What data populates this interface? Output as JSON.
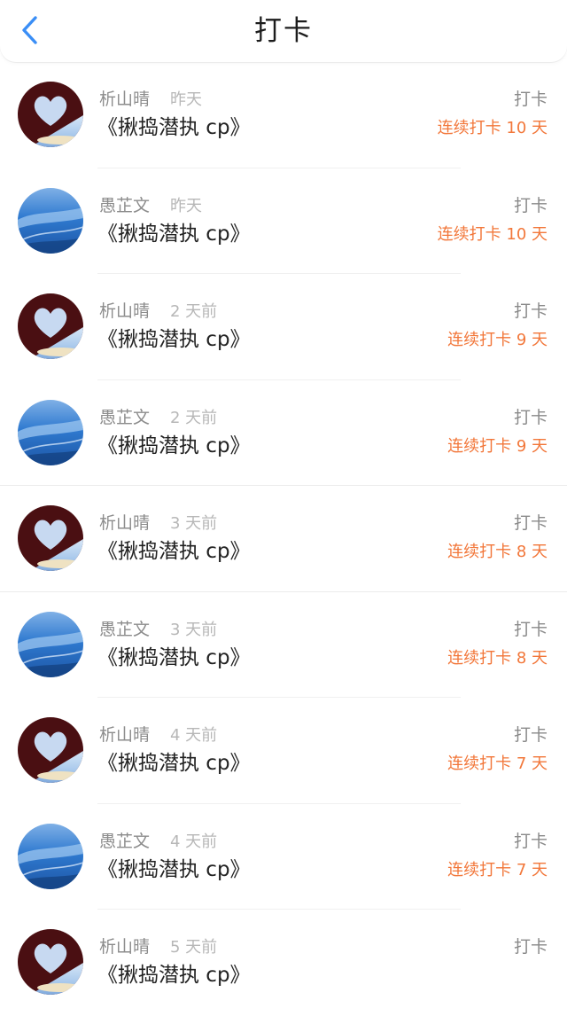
{
  "header": {
    "title": "打卡",
    "back_icon": "chevron-left-icon",
    "accent": "#3a8ef6"
  },
  "colors": {
    "streak": "#f2773a",
    "name": "#8c8c8c",
    "time": "#b7b7b7"
  },
  "entries": [
    {
      "name": "析山晴",
      "time": "昨天",
      "content": "《揪捣潜执 cp》",
      "tag": "打卡",
      "streak": "连续打卡 10 天",
      "avatar": "heart-avatar"
    },
    {
      "name": "愚芷文",
      "time": "昨天",
      "content": "《揪捣潜执 cp》",
      "tag": "打卡",
      "streak": "连续打卡 10 天",
      "avatar": "ocean-avatar"
    },
    {
      "name": "析山晴",
      "time": "2 天前",
      "content": "《揪捣潜执 cp》",
      "tag": "打卡",
      "streak": "连续打卡 9 天",
      "avatar": "heart-avatar"
    },
    {
      "name": "愚芷文",
      "time": "2 天前",
      "content": "《揪捣潜执 cp》",
      "tag": "打卡",
      "streak": "连续打卡 9 天",
      "avatar": "ocean-avatar"
    },
    {
      "name": "析山晴",
      "time": "3 天前",
      "content": "《揪捣潜执 cp》",
      "tag": "打卡",
      "streak": "连续打卡 8 天",
      "avatar": "heart-avatar"
    },
    {
      "name": "愚芷文",
      "time": "3 天前",
      "content": "《揪捣潜执 cp》",
      "tag": "打卡",
      "streak": "连续打卡 8 天",
      "avatar": "ocean-avatar"
    },
    {
      "name": "析山晴",
      "time": "4 天前",
      "content": "《揪捣潜执 cp》",
      "tag": "打卡",
      "streak": "连续打卡 7 天",
      "avatar": "heart-avatar"
    },
    {
      "name": "愚芷文",
      "time": "4 天前",
      "content": "《揪捣潜执 cp》",
      "tag": "打卡",
      "streak": "连续打卡 7 天",
      "avatar": "ocean-avatar"
    },
    {
      "name": "析山晴",
      "time": "5 天前",
      "content": "《揪捣潜执 cp》",
      "tag": "打卡",
      "streak": "",
      "avatar": "heart-avatar"
    }
  ]
}
